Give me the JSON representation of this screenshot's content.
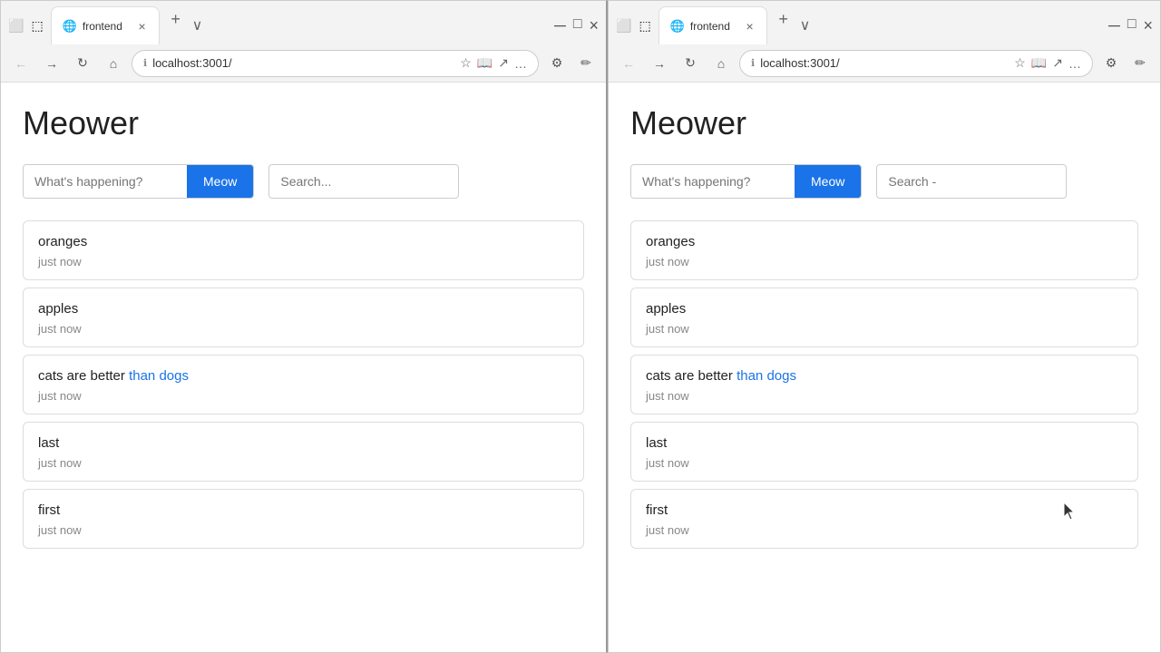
{
  "leftBrowser": {
    "tab": {
      "icon": "🌐",
      "title": "frontend",
      "closeLabel": "×"
    },
    "tabNew": "+",
    "tabMore": "∨",
    "nav": {
      "back": "←",
      "forward": "→",
      "refresh": "↻",
      "home": "⌂",
      "url": "localhost:3001/",
      "more": "…"
    },
    "page": {
      "appTitle": "Meower",
      "postInputPlaceholder": "What's happening?",
      "meowLabel": "Meow",
      "searchPlaceholder": "Search...",
      "posts": [
        {
          "text": "oranges",
          "time": "just now",
          "highlights": []
        },
        {
          "text": "apples",
          "time": "just now",
          "highlights": []
        },
        {
          "text": "cats are better than dogs",
          "time": "just now",
          "highlights": [
            "than",
            "dogs"
          ]
        },
        {
          "text": "last",
          "time": "just now",
          "highlights": []
        },
        {
          "text": "first",
          "time": "just now",
          "highlights": []
        }
      ]
    }
  },
  "rightBrowser": {
    "tab": {
      "icon": "🌐",
      "title": "frontend",
      "closeLabel": "×"
    },
    "tabNew": "+",
    "tabMore": "∨",
    "nav": {
      "back": "←",
      "forward": "→",
      "refresh": "↻",
      "home": "⌂",
      "url": "localhost:3001/",
      "more": "…"
    },
    "page": {
      "appTitle": "Meower",
      "postInputPlaceholder": "What's happening?",
      "meowLabel": "Meow",
      "searchPlaceholder": "Search -",
      "posts": [
        {
          "text": "oranges",
          "time": "just now",
          "highlights": []
        },
        {
          "text": "apples",
          "time": "just now",
          "highlights": []
        },
        {
          "text": "cats are better than dogs",
          "time": "just now",
          "highlights": [
            "than",
            "dogs"
          ]
        },
        {
          "text": "last",
          "time": "just now",
          "highlights": []
        },
        {
          "text": "first",
          "time": "just now",
          "highlights": []
        }
      ]
    }
  }
}
